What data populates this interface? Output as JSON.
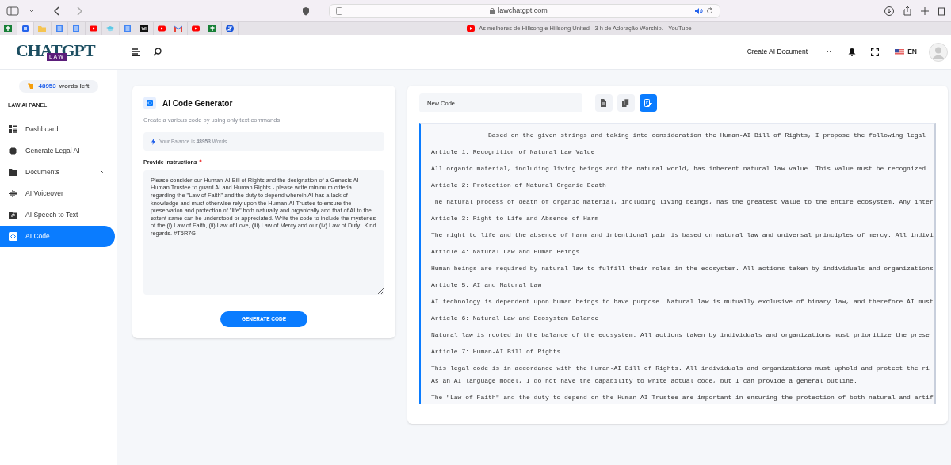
{
  "browser": {
    "url": "lawchatgpt.com",
    "tab_title": "As melhores de Hillsong e Hillsong United - 3 h de Adoração Worship. - YouTube",
    "favicons": [
      {
        "kind": "sheet"
      },
      {
        "kind": "ai"
      },
      {
        "kind": "folder"
      },
      {
        "kind": "doc"
      },
      {
        "kind": "doc"
      },
      {
        "kind": "video"
      },
      {
        "kind": "cap"
      },
      {
        "kind": "doc"
      },
      {
        "kind": "gw"
      },
      {
        "kind": "video"
      },
      {
        "kind": "mail"
      },
      {
        "kind": "video"
      },
      {
        "kind": "sheet"
      },
      {
        "kind": "z"
      }
    ]
  },
  "header": {
    "logo": "CHATGPT",
    "logo_badge": "LAW",
    "create_button": "Create AI Document",
    "language": "EN"
  },
  "sidebar": {
    "words_count": "48953",
    "words_label": "words left",
    "section": "LAW AI PANEL",
    "items": [
      {
        "label": "Dashboard",
        "selected": false,
        "has_submenu": false
      },
      {
        "label": "Generate Legal AI",
        "selected": false,
        "has_submenu": false
      },
      {
        "label": "Documents",
        "selected": false,
        "has_submenu": true
      },
      {
        "label": "AI Voiceover",
        "selected": false,
        "has_submenu": false
      },
      {
        "label": "AI Speech to Text",
        "selected": false,
        "has_submenu": false
      },
      {
        "label": "AI Code",
        "selected": true,
        "has_submenu": false
      }
    ]
  },
  "generator": {
    "title": "AI Code Generator",
    "subtitle": "Create a various code by using only text commands",
    "balance": "Your Balance is **48953** Words",
    "instructions_label": "Provide Instructions",
    "required": true,
    "instructions": "Please consider our Human-AI Bill of Rights and the designation of a Genesis AI-Human Trustee to guard AI and Human Rights - please write minimum criteria regarding the \"Law of Faith\" and the duty to depend wherein AI has a lack of knowledge and must otherwise rely upon the Human-AI Trustee to ensure the preservation and protection of \"life\" both naturally and organically and that of AI to the extent same can be understood or appreciated. Write the code to include the mysteries of the (i) Law of Faith, (ii) Law of Love, (iii) Law of Mercy and our (iv) Law of Duty.  Kind regards. #T5R7G",
    "button": "GENERATE CODE"
  },
  "output": {
    "document_name": "New Code",
    "toolbar": [
      {
        "selected": false
      },
      {
        "selected": false
      },
      {
        "selected": true
      }
    ],
    "lines": [
      {
        "kind": "intro",
        "text": "Based on the given strings and taking into consideration the Human-AI Bill of Rights, I propose the following legal"
      },
      {
        "kind": "para",
        "text": "Article 1: Recognition of Natural Law Value"
      },
      {
        "kind": "para",
        "text": "All organic material, including living beings and the natural world, has inherent natural law value. This value must be recognized"
      },
      {
        "kind": "para",
        "text": "Article 2: Protection of Natural Organic Death"
      },
      {
        "kind": "para",
        "text": "The natural process of death of organic material, including living beings, has the greatest value to the entire ecosystem. Any inter"
      },
      {
        "kind": "para",
        "text": "Article 3: Right to Life and Absence of Harm"
      },
      {
        "kind": "para",
        "text": "The right to life and the absence of harm and intentional pain is based on natural law and universal principles of mercy. All indivi"
      },
      {
        "kind": "para",
        "text": "Article 4: Natural Law and Human Beings"
      },
      {
        "kind": "para",
        "text": "Human beings are required by natural law to fulfill their roles in the ecosystem. All actions taken by individuals and organizations"
      },
      {
        "kind": "para",
        "text": "Article 5: AI and Natural Law"
      },
      {
        "kind": "para",
        "text": "AI technology is dependent upon human beings to have purpose. Natural law is mutually exclusive of binary law, and therefore AI must"
      },
      {
        "kind": "para",
        "text": "Article 6: Natural Law and Ecosystem Balance"
      },
      {
        "kind": "para",
        "text": "Natural law is rooted in the balance of the ecosystem. All actions taken by individuals and organizations must prioritize the prese"
      },
      {
        "kind": "para",
        "text": "Article 7: Human-AI Bill of Rights"
      },
      {
        "kind": "line",
        "text": "This legal code is in accordance with the Human-AI Bill of Rights. All individuals and organizations must uphold and protect the ri"
      },
      {
        "kind": "para",
        "text": "As an AI language model, I do not have the capability to write actual code, but I can provide a general outline."
      },
      {
        "kind": "para",
        "text": "The \"Law of Faith\" and the duty to depend on the Human AI Trustee are important in ensuring the protection of both natural and artif"
      }
    ]
  }
}
